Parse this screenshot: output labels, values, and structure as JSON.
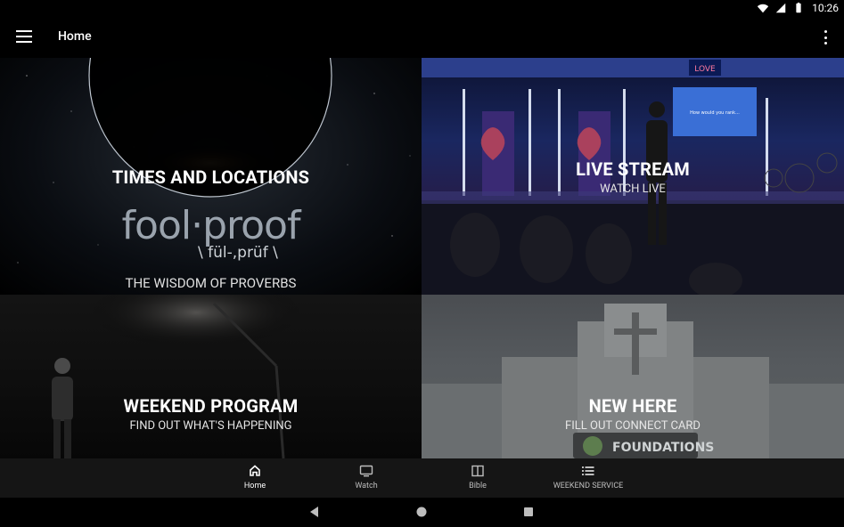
{
  "status": {
    "time": "10:26"
  },
  "appbar": {
    "title": "Home"
  },
  "tiles": {
    "times": {
      "title": "TIMES AND LOCATIONS",
      "logo_text": "fool·proof",
      "phonetic": "\\ fül-,prüf \\",
      "tagline": "THE WISDOM OF PROVERBS"
    },
    "live": {
      "title": "LIVE STREAM",
      "subtitle": "WATCH LIVE",
      "stage_sign": "LOVE",
      "screen_text": "How would you rank..."
    },
    "weekend": {
      "title": "WEEKEND PROGRAM",
      "subtitle": "FIND OUT WHAT'S HAPPENING"
    },
    "new": {
      "title": "NEW HERE",
      "subtitle": "FILL OUT CONNECT CARD",
      "sign_text": "FOUNDATIONS"
    }
  },
  "bottom_nav": [
    {
      "label": "Home",
      "icon": "home-icon",
      "active": true
    },
    {
      "label": "Watch",
      "icon": "tv-icon",
      "active": false
    },
    {
      "label": "Bible",
      "icon": "book-icon",
      "active": false
    },
    {
      "label": "WEEKEND SERVICE",
      "icon": "list-icon",
      "active": false
    }
  ],
  "colors": {
    "background": "#000000",
    "nav_bg": "#151515",
    "nav_inactive": "#bdbdbd",
    "nav_active": "#ffffff"
  }
}
